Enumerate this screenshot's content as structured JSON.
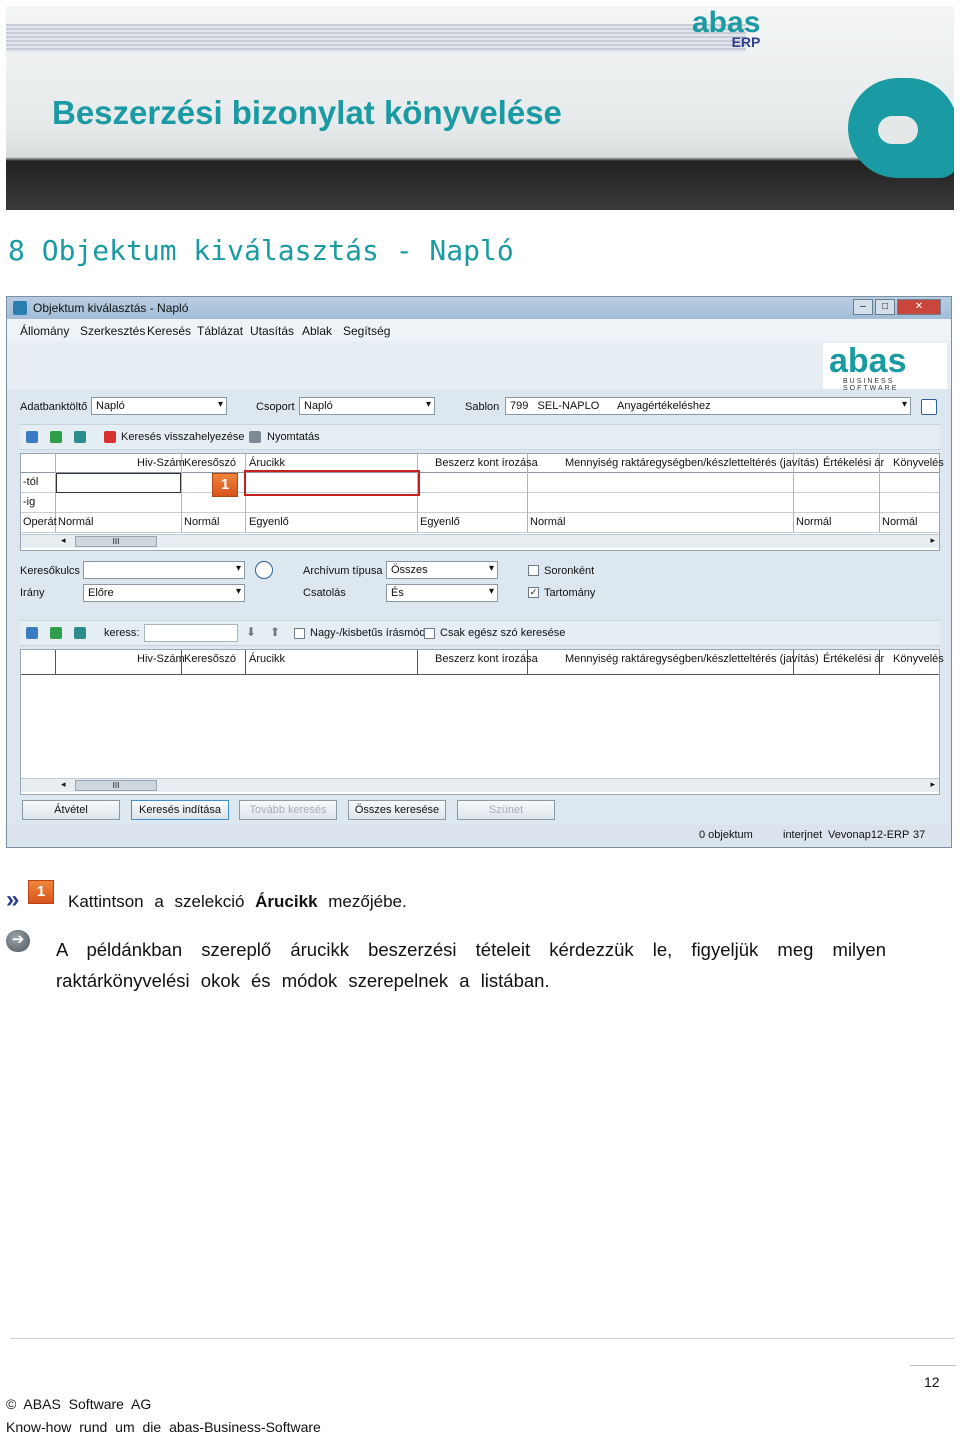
{
  "header": {
    "title": "Beszerzési bizonylat könyvelése",
    "logo_text": "abas",
    "logo_sub": "ERP"
  },
  "section_heading": "8 Objektum kiválasztás - Napló",
  "window": {
    "title": "Objektum kiválasztás - Napló",
    "menu": [
      "Állomány",
      "Szerkesztés",
      "Keresés",
      "Táblázat",
      "Utasítás",
      "Ablak",
      "Segítség"
    ],
    "logo": {
      "name": "abas",
      "sub": "BUSINESS SOFTWARE"
    },
    "adatbank_label": "Adatbanktöltő",
    "adatbank_value": "Napló",
    "csoport_label": "Csoport",
    "csoport_value": "Napló",
    "sablon_label": "Sablon",
    "sablon_num": "799",
    "sablon_code": "SEL-NAPLO",
    "sablon_desc": "Anyagértékeléshez",
    "toolbar1": {
      "reset": "Keresés visszahelyezése",
      "print": "Nyomtatás"
    },
    "columns": [
      "Hiv-Szám",
      "Keresőszó",
      "Árucikk",
      "Beszerz kont írozása",
      "Mennyiség raktáregységben/készletteltérés (javítás)",
      "Értékelési ár",
      "Könyvelés"
    ],
    "rows": {
      "tol": "-tól",
      "ig": "-ig",
      "operator": "Operát"
    },
    "operator_values": [
      "Normál",
      "Normál",
      "Egyenlő",
      "Egyenlő",
      "Normál",
      "Normál",
      "Normál"
    ],
    "keresokulcs_label": "Keresőkulcs",
    "irany_label": "Irány",
    "irany_value": "Előre",
    "archiv_label": "Archívum típusa",
    "archiv_value": "Összes",
    "csatolas_label": "Csatolás",
    "csatolas_value": "És",
    "soronkent": "Soronként",
    "tartomany": "Tartomány",
    "search_label": "keress:",
    "case_label": "Nagy-/kisbetűs írásmód",
    "whole_label": "Csak egész szó keresése",
    "scroll_mark": "III",
    "buttons": [
      "Átvétel",
      "Keresés indítása",
      "Tovább keresés",
      "Összes keresése",
      "Szünet"
    ],
    "status": [
      "0 objektum",
      "interjnet",
      "Vevonap12-ERP",
      "37"
    ],
    "badge": "1"
  },
  "instruction": {
    "badge": "1",
    "pre": "Kattintson a szelekció",
    "bold": "Árucikk",
    "post": "mezőjébe."
  },
  "paragraph": "A példánkban szereplő árucikk beszerzési tételeit kérdezzük le, figyeljük meg milyen raktárkönyvelési okok és módok szerepelnek a listában.",
  "footer": {
    "page": "12",
    "copyright": "© ABAS Software AG",
    "knowhow": "Know-how rund um die abas-Business-Software"
  },
  "colors": {
    "accent": "#1a9aa2",
    "navy": "#2b3e8f",
    "highlight": "#c81f1f"
  }
}
